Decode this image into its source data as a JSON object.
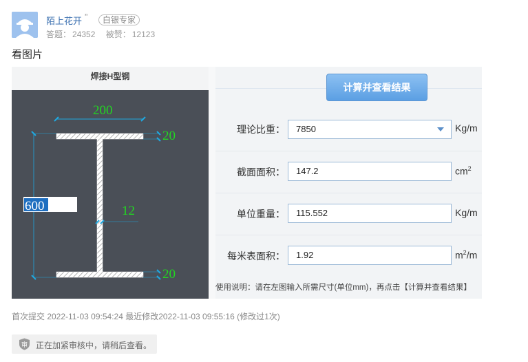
{
  "post": {
    "username": "陌上花开",
    "quote_mark": "”",
    "badge": "白银专家",
    "answers_label": "答题：",
    "answers_count": "24352",
    "likes_label": "被赞：",
    "likes_count": "12123",
    "body_text": "看图片"
  },
  "calculator": {
    "title": "焊接H型钢",
    "button_label": "计算并查看结果",
    "drawing": {
      "top_flange_width": "200",
      "top_flange_thickness": "20",
      "web_thickness": "12",
      "bottom_flange_thickness": "20",
      "height_input": "600"
    },
    "fields": [
      {
        "label": "理论比重：",
        "value": "7850",
        "unit": "Kg/m",
        "unit_sup": "",
        "unit_tail": ""
      },
      {
        "label": "截面面积：",
        "value": "147.2",
        "unit": "cm",
        "unit_sup": "2",
        "unit_tail": ""
      },
      {
        "label": "单位重量：",
        "value": "115.552",
        "unit": "Kg/m",
        "unit_sup": "",
        "unit_tail": ""
      },
      {
        "label": "每米表面积：",
        "value": "1.92",
        "unit": "m",
        "unit_sup": "2",
        "unit_tail": "/m"
      }
    ],
    "usage": "使用说明：请在左图输入所需尺寸(单位mm)，再点击【计算并查看结果】"
  },
  "meta": {
    "timestamps": "首次提交 2022-11-03 09:54:24  最近修改2022-11-03 09:55:16 (修改过1次)",
    "review_notice": "正在加紧审核中，请稍后查看。"
  },
  "colors": {
    "dim_green": "#22d622",
    "dim_cyan": "#1fa8e0",
    "drawing_bg": "#4a4f57",
    "button_blue": "#6aaae8"
  }
}
